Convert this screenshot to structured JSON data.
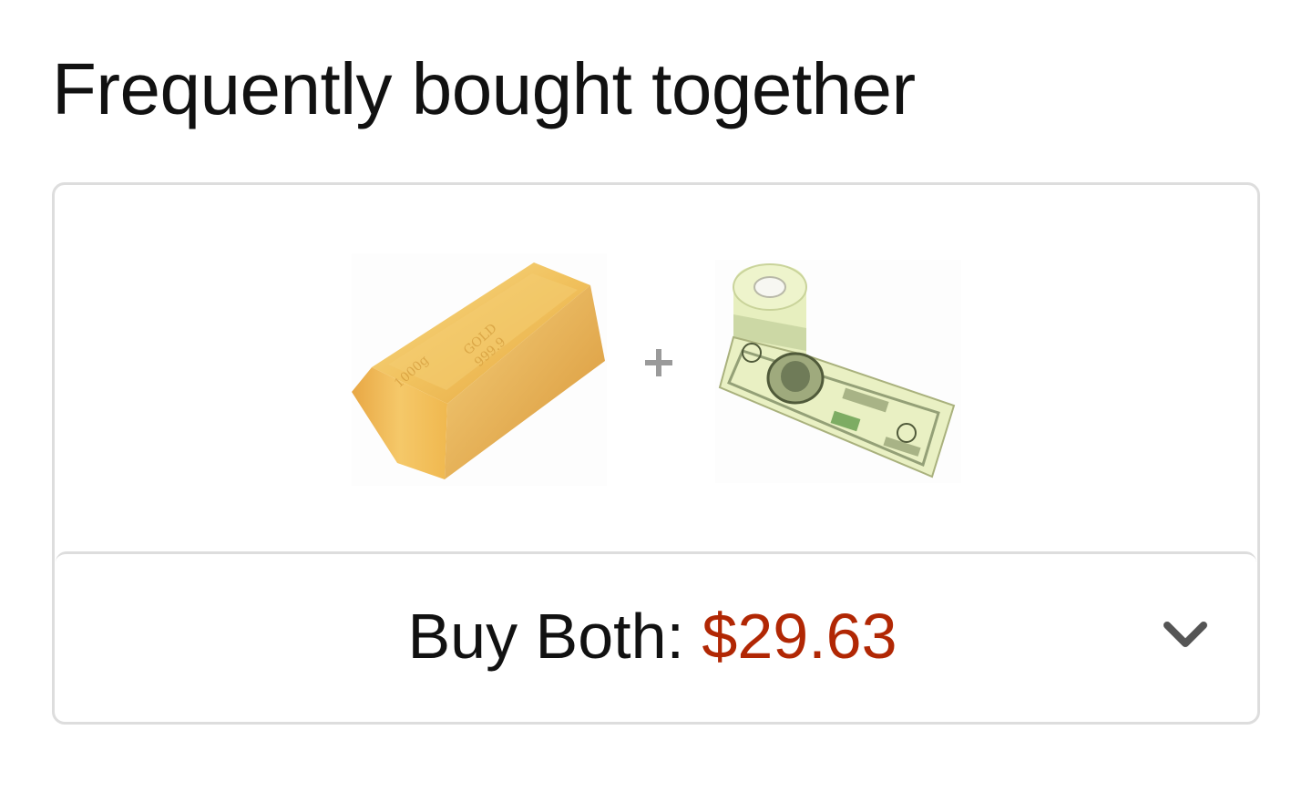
{
  "section": {
    "title": "Frequently bought together"
  },
  "products": [
    {
      "icon": "gold-bar-product-image"
    },
    {
      "icon": "money-toilet-paper-product-image"
    }
  ],
  "bundle": {
    "label": "Buy Both:",
    "price": "$29.63",
    "price_color": "#b12704",
    "expand_icon": "chevron-down-icon"
  },
  "colors": {
    "text": "#111111",
    "border": "#dddddd",
    "plus": "#9a9a9a"
  }
}
